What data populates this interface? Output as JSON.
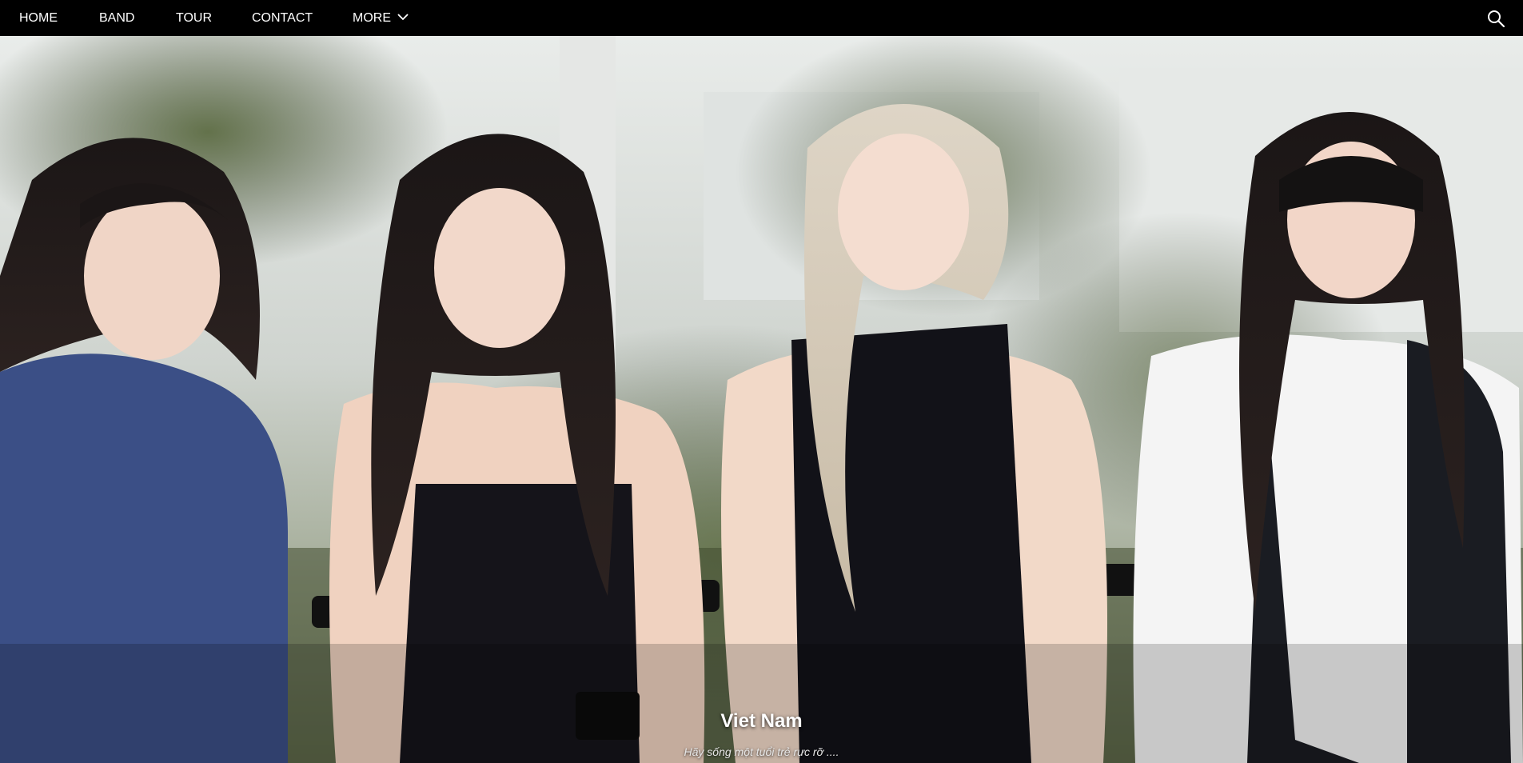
{
  "nav": {
    "items": [
      {
        "label": "HOME"
      },
      {
        "label": "BAND"
      },
      {
        "label": "TOUR"
      },
      {
        "label": "CONTACT"
      },
      {
        "label": "MORE"
      }
    ],
    "more_icon": "chevron-down-icon",
    "search_icon": "search-icon"
  },
  "slide": {
    "title": "Viet Nam",
    "subtitle": "Hãy sống một tuổi trẻ rực rỡ ....",
    "image": "photo-of-four-women-seated-on-chairs"
  },
  "colors": {
    "nav_bg": "#000000",
    "nav_text": "#ffffff"
  }
}
